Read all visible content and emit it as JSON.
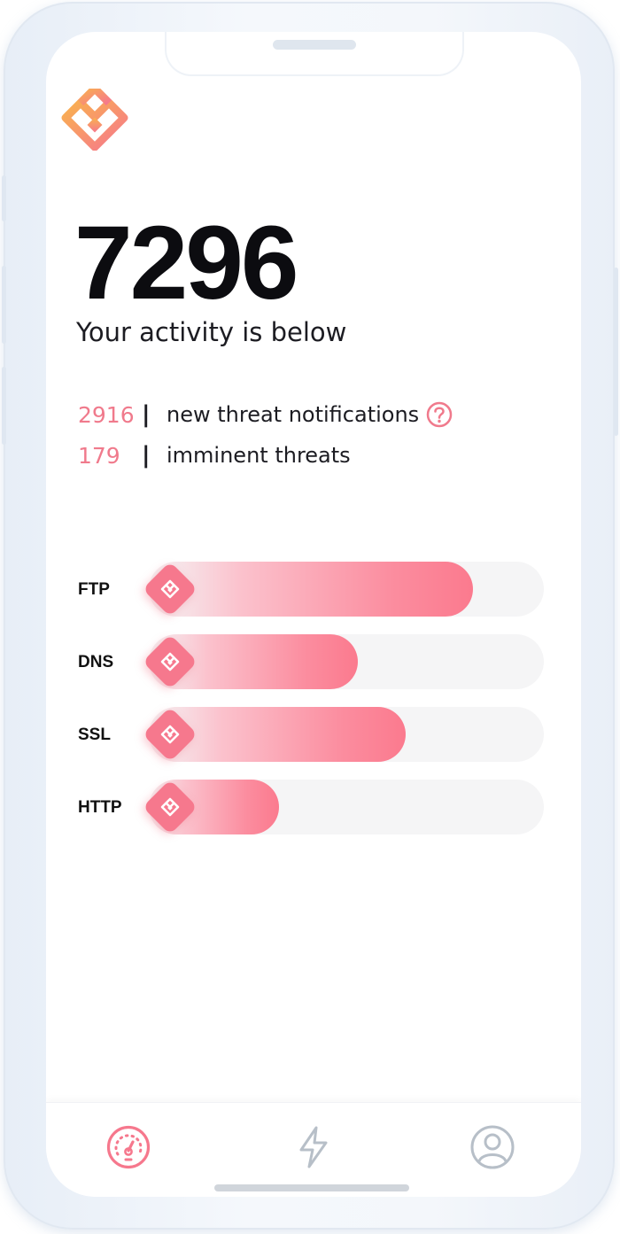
{
  "header": {
    "total_count": "7296",
    "subtitle": "Your activity is below"
  },
  "stats": [
    {
      "value": "2916",
      "separator": "|",
      "label": "new threat notifications",
      "has_help": true
    },
    {
      "value": "179",
      "separator": "|",
      "label": "imminent threats",
      "has_help": false
    }
  ],
  "protocols": [
    {
      "label": "FTP",
      "level": 0.82
    },
    {
      "label": "DNS",
      "level": 0.53
    },
    {
      "label": "SSL",
      "level": 0.65
    },
    {
      "label": "HTTP",
      "level": 0.33
    }
  ],
  "nav": {
    "items": [
      {
        "icon": "dashboard-gauge-icon",
        "active": true
      },
      {
        "icon": "lightning-icon",
        "active": false
      },
      {
        "icon": "user-profile-icon",
        "active": false
      }
    ]
  },
  "colors": {
    "accent": "#f6788d",
    "accent_text": "#f07a8c",
    "logo_gradient_start": "#f9b14e",
    "logo_gradient_end": "#f6788d",
    "inactive_icon": "#b7bfc8"
  }
}
